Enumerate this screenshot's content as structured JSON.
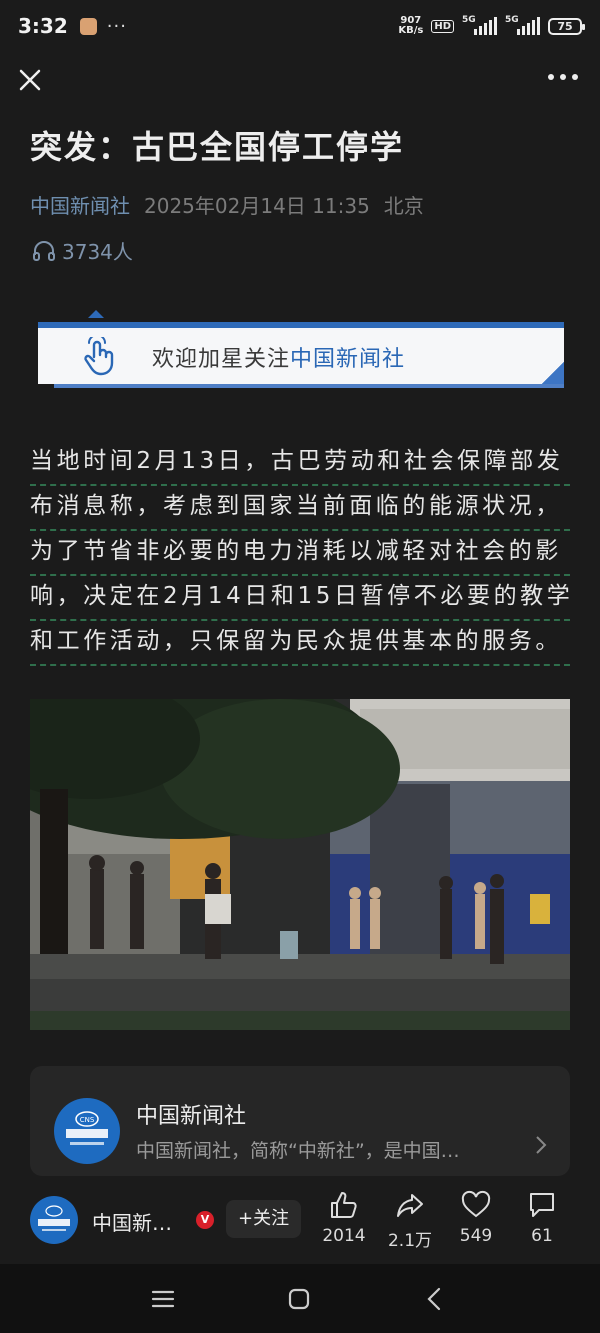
{
  "status_bar": {
    "time": "3:32",
    "net_speed_value": "907",
    "net_speed_unit": "KB/s",
    "hd_label": "HD",
    "signal1": "5G",
    "signal2": "5G",
    "battery": "75"
  },
  "article": {
    "title": "突发：古巴全国停工停学",
    "source": "中国新闻社",
    "datetime": "2025年02月14日 11:35",
    "location": "北京",
    "listen_count": "3734人",
    "banner_prefix": "欢迎加星关注",
    "banner_highlight": "中国新闻社",
    "body_lines": [
      "当地时间2月13日，古巴劳动和社会保障部发",
      "布消息称，考虑到国家当前面临的能源状况，",
      "为了节省非必要的电力消耗以减轻对社会的影",
      "响，决定在2月14日和15日暂停不必要的教学",
      "和工作活动，只保留为民众提供基本的服务。"
    ]
  },
  "account_card": {
    "name": "中国新闻社",
    "description": "中国新闻社，简称“中新社”，是中国…",
    "description_cut": "…  ……"
  },
  "action_bar": {
    "account_name": "中国新…",
    "verified_label": "V",
    "follow_label": "+关注",
    "like_count": "2014",
    "share_count": "2.1万",
    "favorite_count": "549",
    "comment_count": "61"
  },
  "colors": {
    "background": "#1b1b1b",
    "accent_blue": "#2e6ab8",
    "source_blue": "#6f8fb0",
    "verified_red": "#d8202a"
  }
}
